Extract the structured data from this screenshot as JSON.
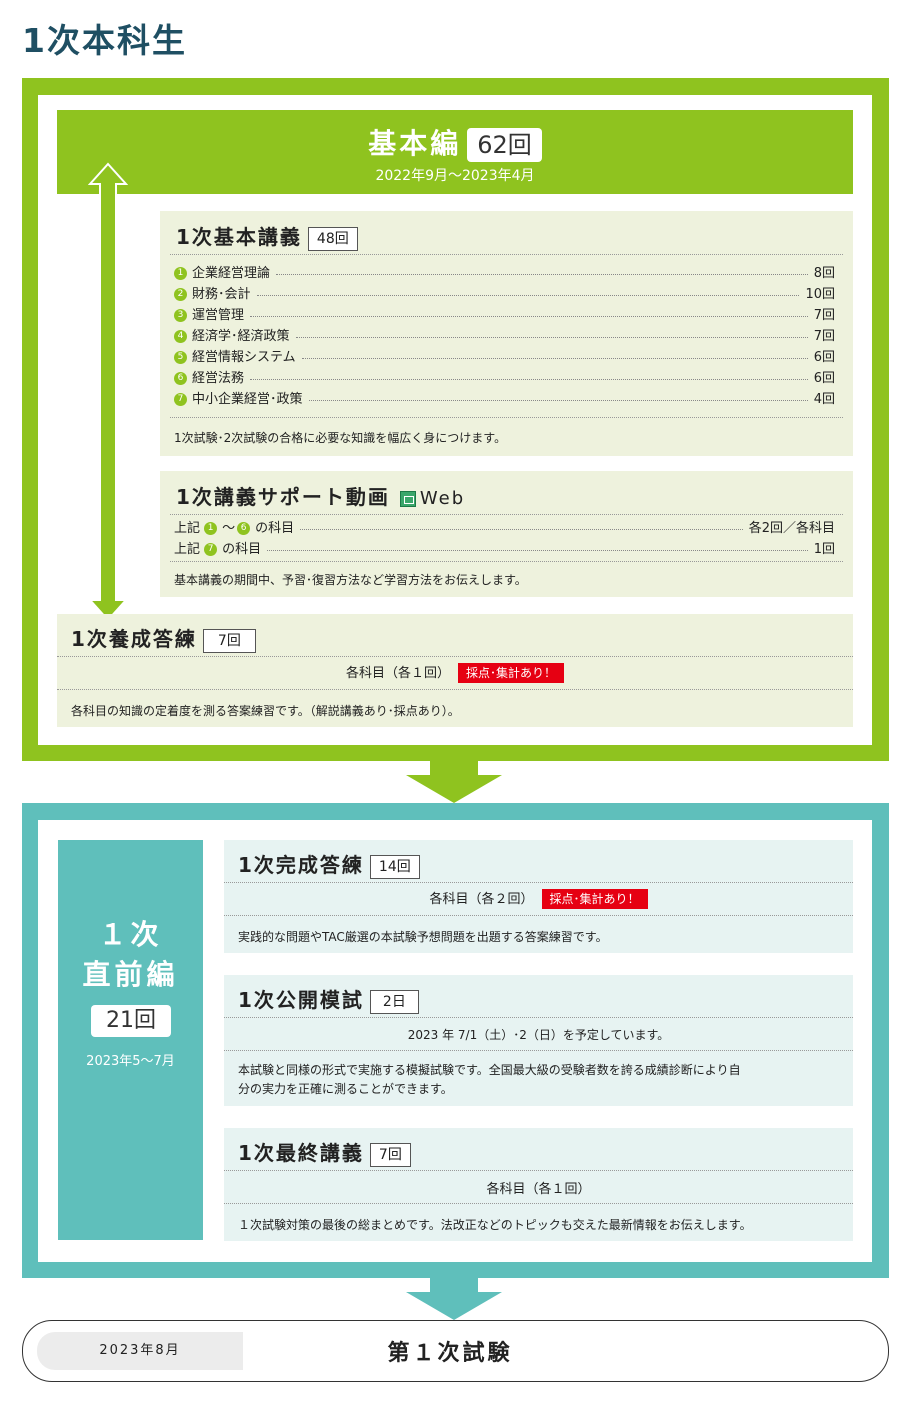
{
  "page_title": "1次本科生",
  "basic": {
    "title": "基本編",
    "count": "62回",
    "period": "2022年9月～2023年4月",
    "lecture": {
      "title": "1次基本講義",
      "count": "48回",
      "items": [
        {
          "no": "1",
          "name": "企業経営理論",
          "value": "8回"
        },
        {
          "no": "2",
          "name": "財務･会計",
          "value": "10回"
        },
        {
          "no": "3",
          "name": "運営管理",
          "value": "7回"
        },
        {
          "no": "4",
          "name": "経済学･経済政策",
          "value": "7回"
        },
        {
          "no": "5",
          "name": "経営情報システム",
          "value": "6回"
        },
        {
          "no": "6",
          "name": "経営法務",
          "value": "6回"
        },
        {
          "no": "7",
          "name": "中小企業経営･政策",
          "value": "4回"
        }
      ],
      "description": "1次試験･2次試験の合格に必要な知識を幅広く身につけます。"
    },
    "support": {
      "title": "1次講義サポート動画",
      "web_label": "Web",
      "rows": [
        {
          "prefix": "上記",
          "from": "1",
          "sep": "～",
          "to": "6",
          "suffix": "の科目",
          "value": "各2回／各科目"
        },
        {
          "prefix": "上記",
          "to": "7",
          "suffix": "の科目",
          "value": "1回"
        }
      ],
      "description": "基本講義の期間中、予習･復習方法など学習方法をお伝えします。"
    },
    "training": {
      "title": "1次養成答練",
      "count": "7回",
      "detail": "各科目（各１回）",
      "badge": "採点･集計あり！",
      "description": "各科目の知識の定着度を測る答案練習です。（解説講義あり･採点あり）。"
    }
  },
  "final_phase": {
    "title_line1": "１次",
    "title_line2": "直前編",
    "count": "21回",
    "period": "2023年5～7月",
    "complete": {
      "title": "1次完成答練",
      "count": "14回",
      "detail": "各科目（各２回）",
      "badge": "採点･集計あり！",
      "description": "実践的な問題やTAC厳選の本試験予想問題を出題する答案練習です。"
    },
    "mock": {
      "title": "1次公開模試",
      "count": "2日",
      "detail": "2023 年 7/1（土）･2（日）を予定しています。",
      "description_line1": "本試験と同様の形式で実施する模擬試験です。全国最大級の受験者数を誇る成績診断により自",
      "description_line2": "分の実力を正確に測ることができます。"
    },
    "last": {
      "title": "1次最終講義",
      "count": "7回",
      "detail": "各科目（各１回）",
      "description": "１次試験対策の最後の総まとめです。法改正などのトピックも交えた最新情報をお伝えします。"
    }
  },
  "exam": {
    "date": "2023年8月",
    "title": "第１次試験"
  },
  "colors": {
    "green": "#8fc31f",
    "teal": "#5fbfbb",
    "red": "#e60012",
    "title": "#1f4f63"
  }
}
